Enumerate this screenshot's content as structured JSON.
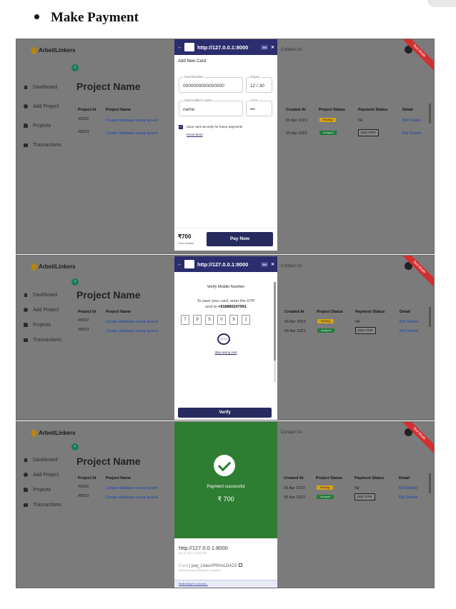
{
  "heading": "Make Payment",
  "app": {
    "brand": "ArbeitLinkers",
    "contact": "Contact Us",
    "ribbon": "Test Mode",
    "page_title": "Project Name",
    "sidebar": [
      "Dashboard",
      "Add Project",
      "Projects",
      "Transactions"
    ],
    "columns": [
      "Project Id",
      "Project Name",
      "Created At",
      "Project Status",
      "Payment Status",
      "Detail"
    ],
    "rows": [
      {
        "id": "#0022",
        "name": "Create database using laravel",
        "created": "09 Apr 2023",
        "status": "Pending",
        "payment": "Nil",
        "detail": "Bid Details"
      },
      {
        "id": "#0023",
        "name": "Create database using laravel",
        "created": "09 Apr 2023",
        "status": "Assigned",
        "payment": "pay now",
        "detail": "Bid Details"
      }
    ]
  },
  "checkout": {
    "url": "http://127.0.0.1:8000",
    "lang": "EN",
    "card_step": {
      "title": "Add New Card",
      "card_number_label": "Card Number",
      "card_number": "0000000000000000",
      "expiry_label": "Expiry",
      "expiry": "12 / 30",
      "holder_label": "Card Holder's name",
      "holder": "name",
      "cvv_label": "CVV",
      "cvv": "•••",
      "save_text": "Save card securely for future payments",
      "know_more": "Know More",
      "amount": "₹700",
      "view_details": "View Details",
      "pay_button": "Pay Now"
    },
    "otp_step": {
      "title": "Verify Mobile Number",
      "desc_line1": "To save your card, enter the OTP",
      "desc_prefix": "sent to",
      "phone": "+918880247991",
      "digits": [
        "7",
        "9",
        "5",
        "0",
        "9",
        "1"
      ],
      "spinner": "00:00",
      "skip": "Skip saving card",
      "verify_button": "Verify"
    },
    "success_step": {
      "message": "Payment successful",
      "amount": "₹ 700",
      "merchant_url": "http://127.0.0.1:8000",
      "date": "Apr 9, 2023 | 09:54 PM",
      "card_label": "Card",
      "payment_id": "pay_LbeuVPKhsLDA23",
      "note": "Visit razorpay.com/support for queries",
      "redirect": "Redirecting in 1 seconds..."
    }
  },
  "colors": {
    "checkout_header": "#2b2d6e",
    "success_green": "#2e7d32",
    "pending": "#d4a21b",
    "assigned": "#1f7d3c"
  }
}
